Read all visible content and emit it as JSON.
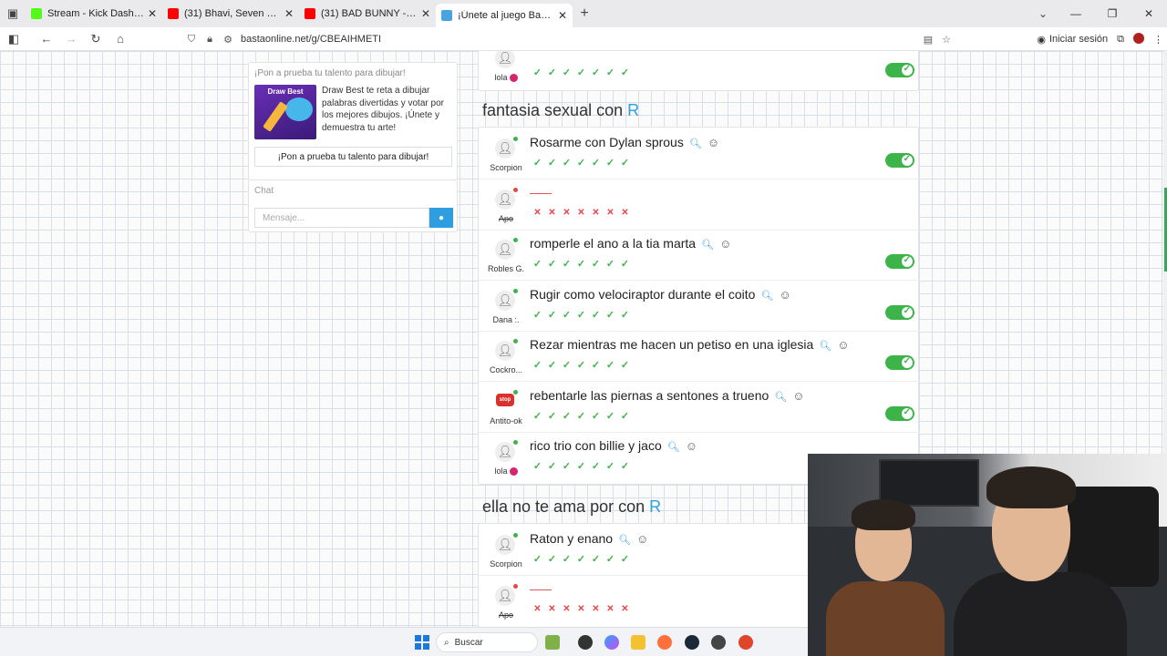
{
  "browser": {
    "tabs": [
      {
        "title": "Stream - Kick Dashboard",
        "favicon_color": "#53fc18",
        "active": false
      },
      {
        "title": "(31) Bhavi, Seven Kayne, Shako",
        "favicon_color": "#ff0000",
        "active": false
      },
      {
        "title": "(31) BAD BUNNY - BOOKER T (V",
        "favicon_color": "#ff0000",
        "active": false
      },
      {
        "title": "¡Únete al juego Basta!",
        "favicon_color": "#4aa3df",
        "active": true
      }
    ],
    "new_tab": "+",
    "url": "bastaonline.net/g/CBEAIHMETI",
    "sign_in": "Iniciar sesión"
  },
  "sidebar": {
    "promo": {
      "heading": "¡Pon a prueba tu talento para dibujar!",
      "image_label": "Draw Best",
      "text": "Draw Best te reta a dibujar palabras divertidas y votar por los mejores dibujos. ¡Únete y demuestra tu arte!",
      "button": "¡Pon a prueba tu talento para dibujar!"
    },
    "chat": {
      "heading": "Chat",
      "placeholder": "Mensaje..."
    }
  },
  "categories": [
    {
      "title": "",
      "letter": "",
      "rows": [
        {
          "player": "lola",
          "answer": "",
          "valid": true,
          "edited": true,
          "online": true
        }
      ]
    },
    {
      "title": "fantasia sexual con",
      "letter": "R",
      "rows": [
        {
          "player": "Scorpion",
          "answer": "Rosarme con Dylan sprous",
          "valid": true,
          "online": true
        },
        {
          "player": "Apo",
          "answer": "",
          "valid": false,
          "online": false
        },
        {
          "player": "Robles G.",
          "answer": "romperle el ano a la tia marta",
          "valid": true,
          "online": true
        },
        {
          "player": "Dana :.",
          "answer": "Rugir como velociraptor durante el coito",
          "valid": true,
          "online": true
        },
        {
          "player": "Cockro...",
          "answer": "Rezar mientras me hacen un petiso en una iglesia",
          "valid": true,
          "online": true
        },
        {
          "player": "Antito-ok",
          "answer": "rebentarle las piernas a sentones a trueno",
          "valid": true,
          "online": true,
          "stop": true
        },
        {
          "player": "lola",
          "answer": "rico trio con billie y jaco",
          "valid": true,
          "edited": true,
          "online": true
        }
      ]
    },
    {
      "title": "ella no te ama por con",
      "letter": "R",
      "rows": [
        {
          "player": "Scorpion",
          "answer": "Raton y enano",
          "valid": true,
          "online": true
        },
        {
          "player": "Apo",
          "answer": "",
          "valid": false,
          "online": false
        }
      ]
    }
  ],
  "stop_label": "stop",
  "taskbar": {
    "search": "Buscar"
  },
  "colors": {
    "accent": "#2f9ee0",
    "valid": "#3cb44a",
    "invalid": "#e5474b"
  }
}
